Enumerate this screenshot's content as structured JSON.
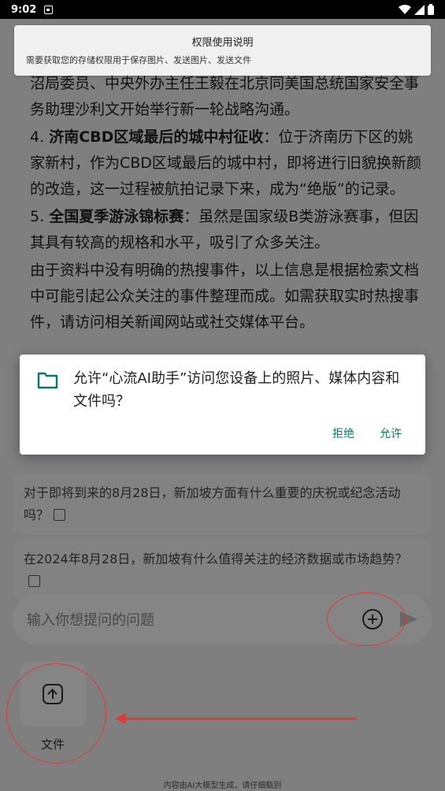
{
  "status_bar": {
    "time": "9:02"
  },
  "answer": {
    "cut_line": "沼局委员、中央外办主任王毅在北京同美国总统国家安全事务助理沙利文开始举行新一轮战略沟通。",
    "item4_num": "4.",
    "item4_title": "济南CBD区域最后的城中村征收",
    "item4_text": "：位于济南历下区的姚家新村，作为CBD区域最后的城中村，即将进行旧貌换新颜的改造，这一过程被航拍记录下来，成为“绝版”的记录。",
    "item5_num": "5.",
    "item5_title": "全国夏季游泳锦标赛",
    "item5_text": "：虽然是国家级B类游泳赛事，但因其具有较高的规格和水平，吸引了众多关注。",
    "closing": "由于资料中没有明确的热搜事件，以上信息是根据检索文档中可能引起公众关注的事件整理而成。如需获取实时热搜事件，请访问相关新闻网站或社交媒体平台。"
  },
  "suggestions": [
    "对于即将到来的8月28日，新加坡方面有什么重要的庆祝或纪念活动吗？",
    "在2024年8月28日，新加坡有什么值得关注的经济数据或市场趋势？"
  ],
  "input": {
    "placeholder": "输入你想提问的问题"
  },
  "attach": {
    "file_label": "文件"
  },
  "footer": "内容由AI大模型生成，请仔细甄别",
  "permission_banner": {
    "title": "权限使用说明",
    "desc": "需要获取您的存储权限用于保存图片、发送图片、发送文件"
  },
  "dialog": {
    "message": "允许“心流AI助手”访问您设备上的照片、媒体内容和文件吗？",
    "deny": "拒绝",
    "allow": "允许"
  },
  "colors": {
    "accent": "#00796b",
    "annotation": "#e53935"
  }
}
